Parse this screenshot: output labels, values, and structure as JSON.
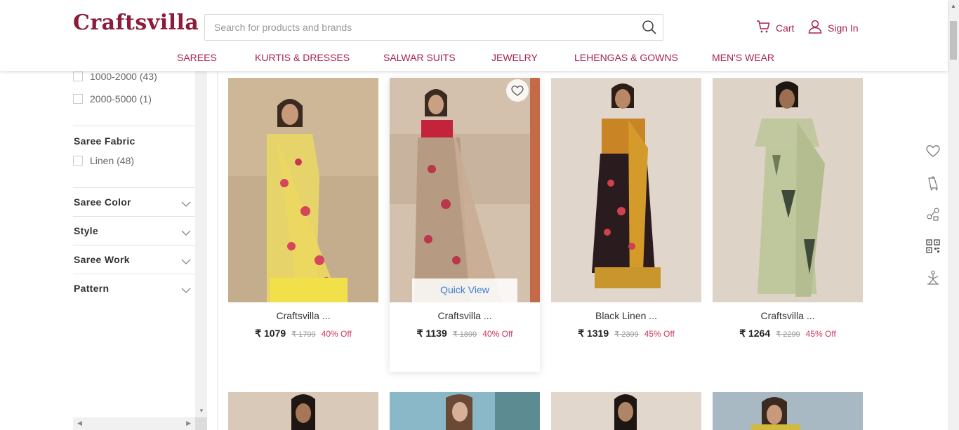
{
  "header": {
    "logo": "Craftsvilla",
    "search_placeholder": "Search for products and brands",
    "cart_label": "Cart",
    "signin_label": "Sign In"
  },
  "nav": [
    "SAREES",
    "KURTIS & DRESSES",
    "SALWAR SUITS",
    "JEWELRY",
    "LEHENGAS & GOWNS",
    "MEN'S WEAR"
  ],
  "filters": {
    "price_options": [
      {
        "label": "1000-2000 (43)"
      },
      {
        "label": "2000-5000 (1)"
      }
    ],
    "fabric_title": "Saree Fabric",
    "fabric_options": [
      {
        "label": "Linen (48)"
      }
    ],
    "accordions": [
      "Saree Color",
      "Style",
      "Saree Work",
      "Pattern"
    ]
  },
  "products": [
    {
      "name": "Craftsvilla ...",
      "price": "₹ 1079",
      "mrp": "₹ 1799",
      "off": "40% Off"
    },
    {
      "name": "Craftsvilla ...",
      "price": "₹ 1139",
      "mrp": "₹ 1899",
      "off": "40% Off",
      "quick_view": "Quick View"
    },
    {
      "name": "Black Linen ...",
      "price": "₹ 1319",
      "mrp": "₹ 2399",
      "off": "45% Off"
    },
    {
      "name": "Craftsvilla ...",
      "price": "₹ 1264",
      "mrp": "₹ 2299",
      "off": "45% Off"
    }
  ],
  "right_rail_icons": [
    "wishlist-icon",
    "bag-icon",
    "share-icon",
    "qr-code-icon",
    "yoga-icon"
  ],
  "colors": {
    "brand": "#8b1c3c",
    "accent": "#a8234e",
    "discount": "#d23359",
    "quick_view": "#3a7bd5"
  }
}
